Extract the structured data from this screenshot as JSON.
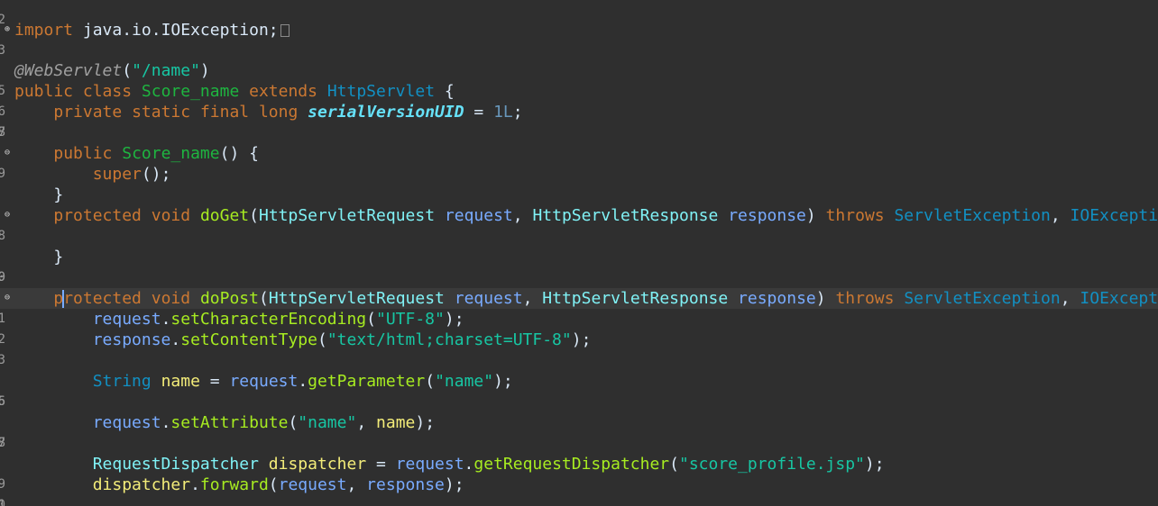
{
  "editor": {
    "line_numbers": [
      "2",
      "3",
      "",
      "5",
      "6",
      "7",
      "8",
      "9",
      "",
      "",
      "",
      "8",
      "9",
      "0",
      "1",
      "2",
      "3",
      "",
      "5",
      "6",
      "7",
      "8",
      "9",
      "0",
      "1",
      "2"
    ],
    "tokens": {
      "import": "import",
      "import_path": "java.io.IOException;",
      "annotation": "@WebServlet",
      "servlet_path": "\"/name\"",
      "public": "public",
      "class": "class",
      "class_name": "Score_name",
      "extends": "extends",
      "super_class": "HttpServlet",
      "private": "private",
      "static": "static",
      "final": "final",
      "long": "long",
      "serial_field": "serialVersionUID",
      "serial_value": "1L",
      "super": "super",
      "protected": "protected",
      "void": "void",
      "do_get": "doGet",
      "req_type": "HttpServletRequest",
      "request": "request",
      "resp_type": "HttpServletResponse",
      "response": "response",
      "throws": "throws",
      "servlet_exception": "ServletException",
      "io_exception": "IOException",
      "do_post": "doPost",
      "protected_p": "p",
      "protected_rest": "rotected",
      "set_char_enc": "setCharacterEncoding",
      "utf8": "\"UTF-8\"",
      "set_content_type": "setContentType",
      "content_type_value": "\"text/html;charset=UTF-8\"",
      "string": "String",
      "name": "name",
      "get_parameter": "getParameter",
      "name_str": "\"name\"",
      "set_attribute": "setAttribute",
      "request_dispatcher": "RequestDispatcher",
      "dispatcher": "dispatcher",
      "get_request_dispatcher": "getRequestDispatcher",
      "jsp_path": "\"score_profile.jsp\"",
      "forward": "forward"
    }
  }
}
